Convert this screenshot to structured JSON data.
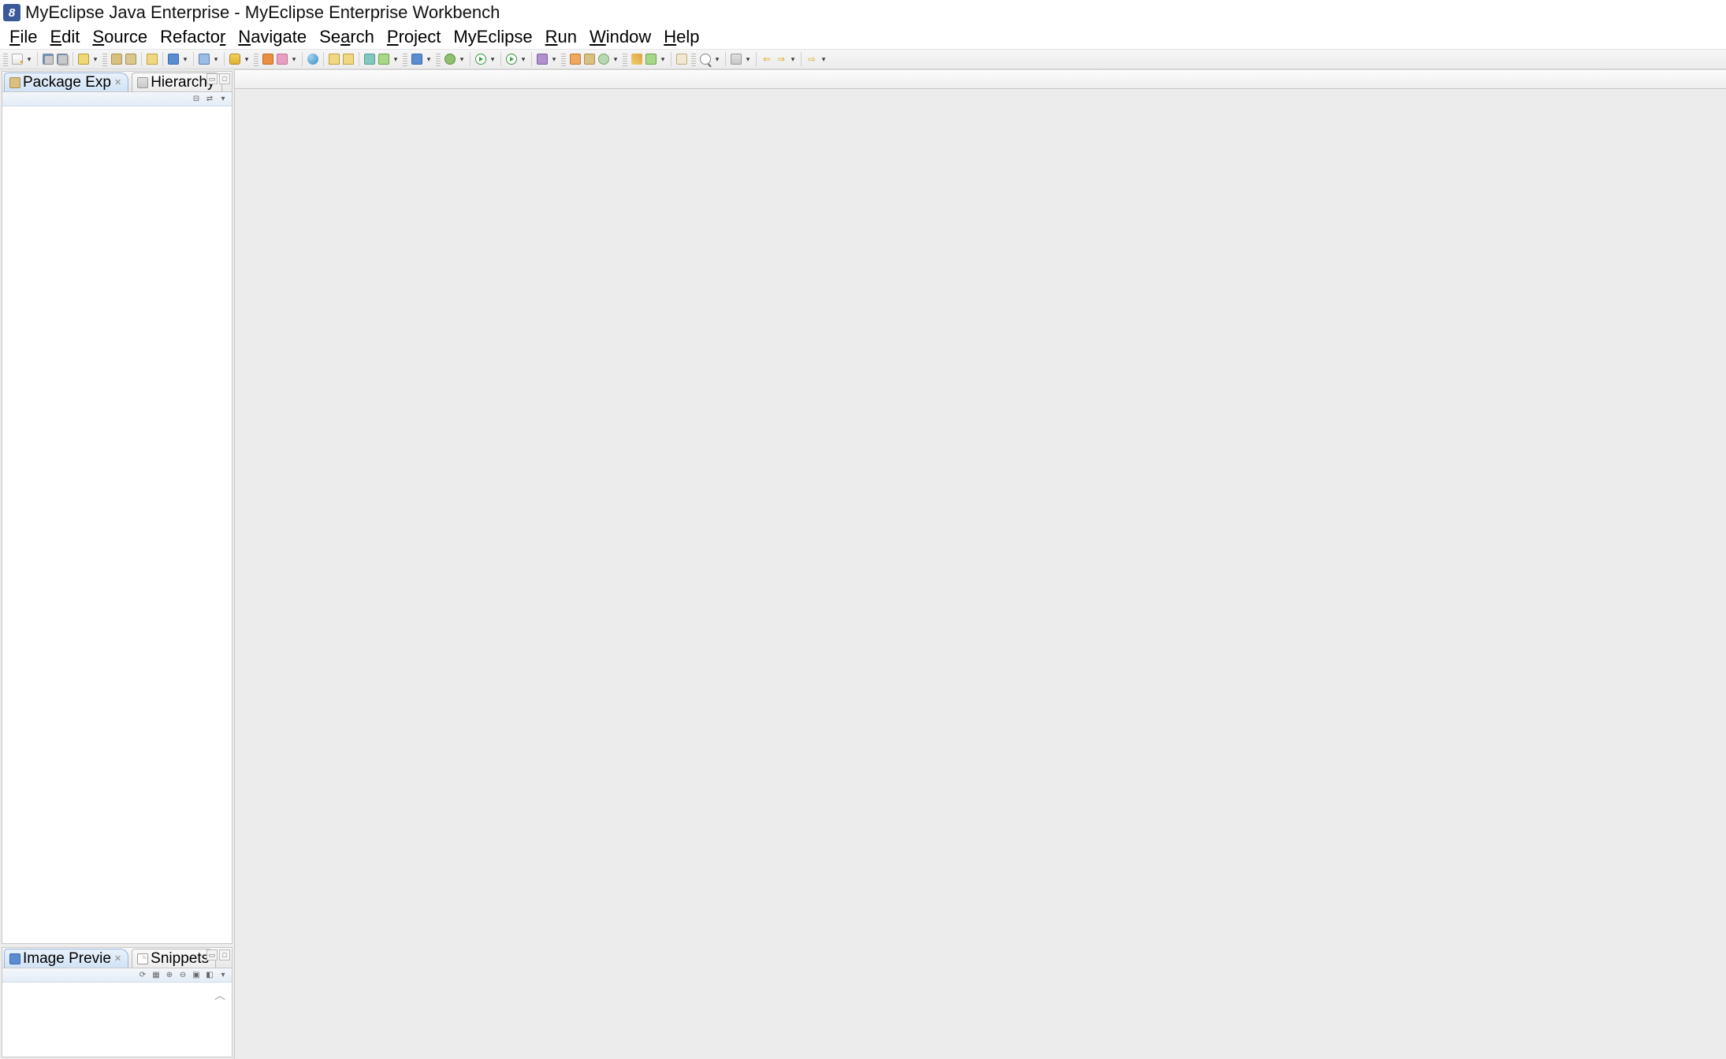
{
  "title": "MyEclipse Java Enterprise - MyEclipse Enterprise Workbench",
  "menu": {
    "file": {
      "label": "File",
      "mn": "F"
    },
    "edit": {
      "label": "Edit",
      "mn": "E"
    },
    "source": {
      "label": "Source",
      "mn": "S"
    },
    "refactor": {
      "label": "Refactor",
      "mn": ""
    },
    "navigate": {
      "label": "Navigate",
      "mn": "N"
    },
    "search": {
      "label": "Search",
      "mn": ""
    },
    "project": {
      "label": "Project",
      "mn": "P"
    },
    "myeclipse": {
      "label": "MyEclipse",
      "mn": ""
    },
    "run": {
      "label": "Run",
      "mn": "R"
    },
    "window": {
      "label": "Window",
      "mn": "W"
    },
    "help": {
      "label": "Help",
      "mn": "H"
    }
  },
  "views": {
    "package_explorer": {
      "label": "Package Exp"
    },
    "hierarchy": {
      "label": "Hierarchy"
    },
    "image_preview": {
      "label": "Image Previe"
    },
    "snippets": {
      "label": "Snippets"
    }
  },
  "toolbar": {
    "new": "new",
    "save": "save",
    "saveall": "save-all",
    "open_type": "open-type",
    "open_pkg": "open-package",
    "build": "build",
    "debug": "debug",
    "run": "run",
    "run_ext": "run-external",
    "search": "search",
    "new_class": "new-class",
    "new_pkg": "new-package",
    "back": "back",
    "forward": "forward",
    "last_edit": "last-edit",
    "pin": "pin",
    "globe": "browser",
    "profile": "profile"
  }
}
